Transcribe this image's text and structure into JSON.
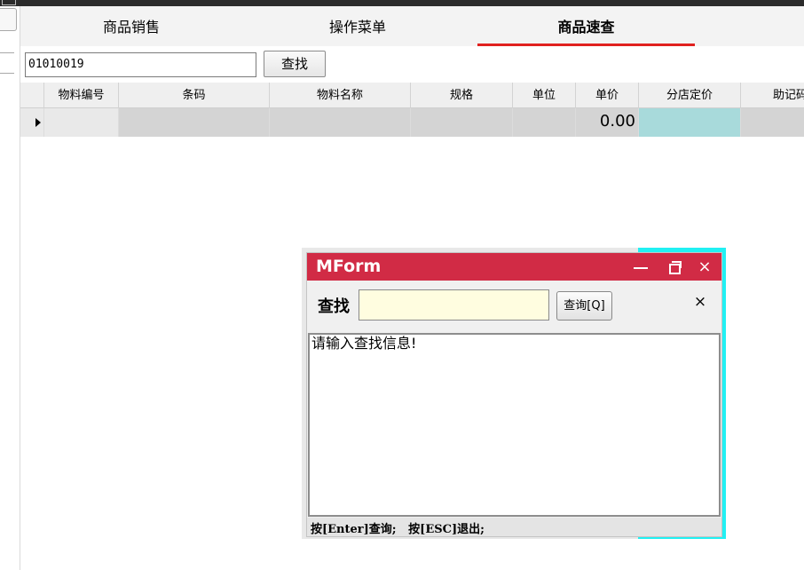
{
  "tabs": [
    {
      "label": "商品销售"
    },
    {
      "label": "操作菜单"
    },
    {
      "label": "商品速查"
    }
  ],
  "search": {
    "value": "01010019",
    "button_label": "查找"
  },
  "grid": {
    "columns": [
      "物料编号",
      "条码",
      "物料名称",
      "规格",
      "单位",
      "单价",
      "分店定价",
      "助记码"
    ],
    "rows": [
      {
        "unit_price": "0.00"
      }
    ]
  },
  "dialog": {
    "title": "MForm",
    "find_label": "查找",
    "find_value": "",
    "query_button_label": "查询[Q]",
    "close_label": "×",
    "result_message": "请输入查找信息!",
    "status_hint": "按[Enter]查询;   按[ESC]退出;",
    "window_buttons": {
      "minimize": "minimize-icon",
      "restore": "restore-icon",
      "close": "×"
    }
  },
  "colors": {
    "titlebar": "#d12b45",
    "active_tab_underline": "#e0211f",
    "highlight_cell": "#a8dadb",
    "find_input_bg": "#fffde0",
    "frame_cyan": "#21f0f3"
  }
}
